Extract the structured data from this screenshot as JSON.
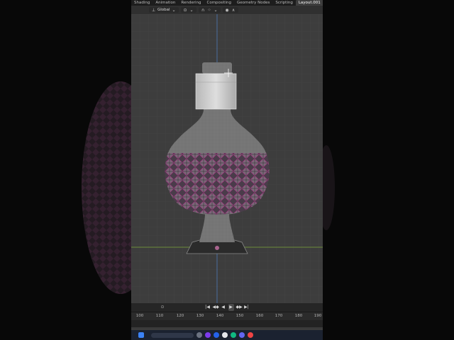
{
  "workspace_tabs": [
    {
      "label": "Shading",
      "active": false
    },
    {
      "label": "Animation",
      "active": false
    },
    {
      "label": "Rendering",
      "active": false
    },
    {
      "label": "Compositing",
      "active": false
    },
    {
      "label": "Geometry Nodes",
      "active": false
    },
    {
      "label": "Scripting",
      "active": false
    },
    {
      "label": "Layout.001",
      "active": true
    }
  ],
  "add_workspace_label": "+",
  "header": {
    "transform_orientation": "Global",
    "pivot_icon": "pivot-icon",
    "snap_icon": "snap-magnet-icon",
    "proportional_icon": "proportional-edit-icon"
  },
  "playback": {
    "jump_start": "|◀",
    "key_prev": "◀◆",
    "play_reverse": "◀",
    "play": "▶",
    "key_next": "◆▶",
    "jump_end": "▶|"
  },
  "timeline": {
    "ticks": [
      "100",
      "110",
      "120",
      "130",
      "140",
      "150",
      "160",
      "170",
      "180",
      "190"
    ]
  },
  "colors": {
    "viewport_bg": "#3d3d3d",
    "grid_line": "#474747",
    "x_axis": "#7ea83c",
    "z_axis": "#4a77b3",
    "mesh_base": "#7a7a7a",
    "mesh_magenta": "#8a2f6a",
    "cap": "#c9c9c9"
  }
}
